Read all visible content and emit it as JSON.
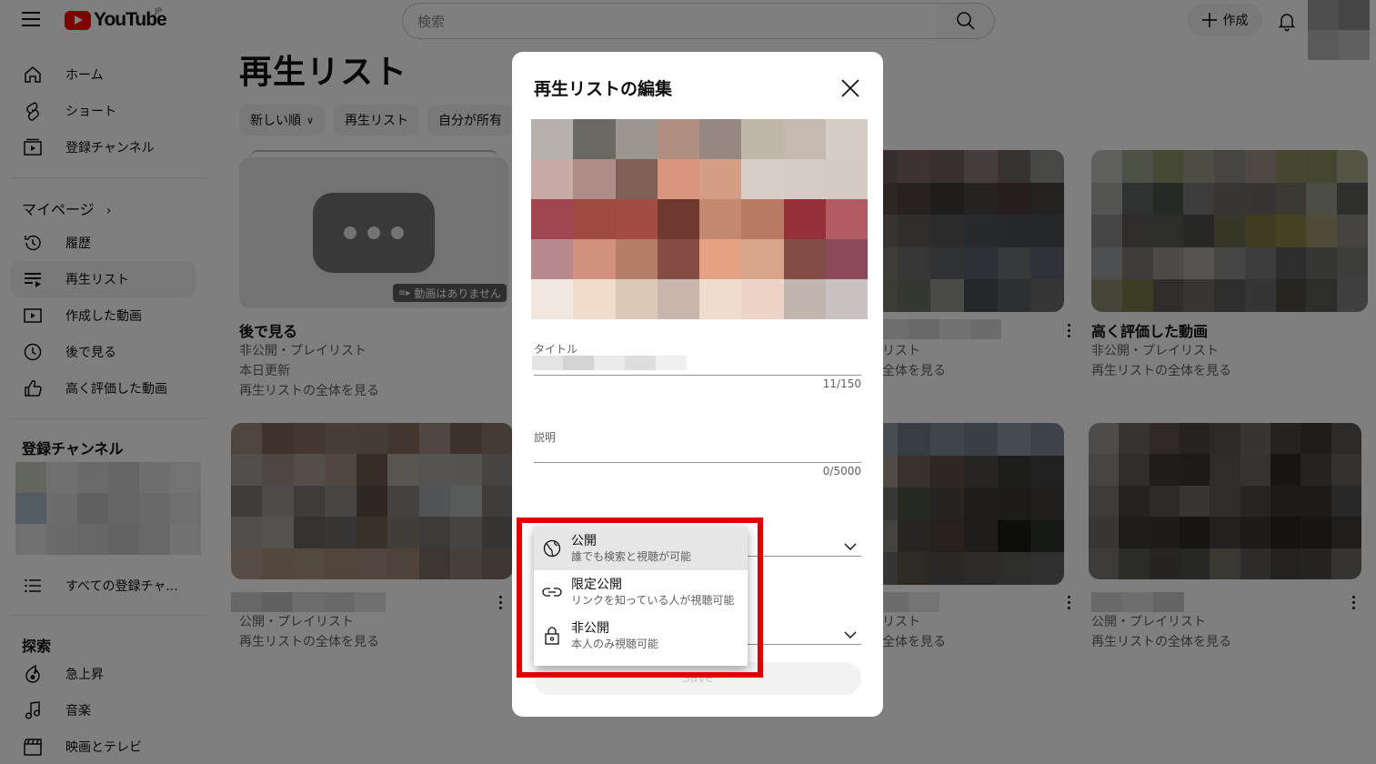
{
  "header": {
    "logo_text": "YouTube",
    "logo_region": "JP",
    "search_placeholder": "検索",
    "create_label": "作成"
  },
  "sidebar": {
    "main": [
      {
        "label": "ホーム",
        "icon": "home-icon"
      },
      {
        "label": "ショート",
        "icon": "shorts-icon"
      },
      {
        "label": "登録チャンネル",
        "icon": "subscriptions-icon"
      }
    ],
    "mypage_heading": "マイページ",
    "mypage": [
      {
        "label": "履歴",
        "icon": "history-icon"
      },
      {
        "label": "再生リスト",
        "icon": "playlists-icon",
        "active": true
      },
      {
        "label": "作成した動画",
        "icon": "your-videos-icon"
      },
      {
        "label": "後で見る",
        "icon": "watch-later-icon"
      },
      {
        "label": "高く評価した動画",
        "icon": "liked-icon"
      }
    ],
    "subscriptions_heading": "登録チャンネル",
    "all_subscriptions": "すべての登録チャ...",
    "explore_heading": "探索",
    "explore": [
      {
        "label": "急上昇",
        "icon": "trending-icon"
      },
      {
        "label": "音楽",
        "icon": "music-icon"
      },
      {
        "label": "映画とテレビ",
        "icon": "movies-icon"
      }
    ]
  },
  "main": {
    "title": "再生リスト",
    "chips": [
      "新しい順",
      "再生リスト",
      "自分が所有"
    ],
    "cards": [
      {
        "title": "後で見る",
        "line1": "非公開・プレイリスト",
        "line2": "本日更新",
        "link": "再生リストの全体を見る",
        "badge": "動画はありません"
      },
      {
        "title": "",
        "line1": "リスト",
        "link": "全体を見る"
      },
      {
        "title": "高く評価した動画",
        "line1": "非公開・プレイリスト",
        "link": "再生リストの全体を見る"
      },
      {
        "line1": "公開・プレイリスト",
        "link": "再生リストの全体を見る"
      },
      {
        "line1": "リスト",
        "link": "全体を見る"
      },
      {
        "line1": "公開・プレイリスト",
        "link": "再生リストの全体を見る"
      }
    ]
  },
  "dialog": {
    "title": "再生リストの編集",
    "title_field_label": "タイトル",
    "title_count": "11/150",
    "description_label": "説明",
    "description_count": "0/5000",
    "save_label": "Save",
    "visibility_options": [
      {
        "label": "公開",
        "description": "誰でも検索と視聴が可能",
        "icon": "globe-icon",
        "selected": true
      },
      {
        "label": "限定公開",
        "description": "リンクを知っている人が視聴可能",
        "icon": "link-icon"
      },
      {
        "label": "非公開",
        "description": "本人のみ視聴可能",
        "icon": "lock-icon"
      }
    ]
  },
  "colors": {
    "accent_red": "#ff0000",
    "highlight_red": "#e00000"
  }
}
